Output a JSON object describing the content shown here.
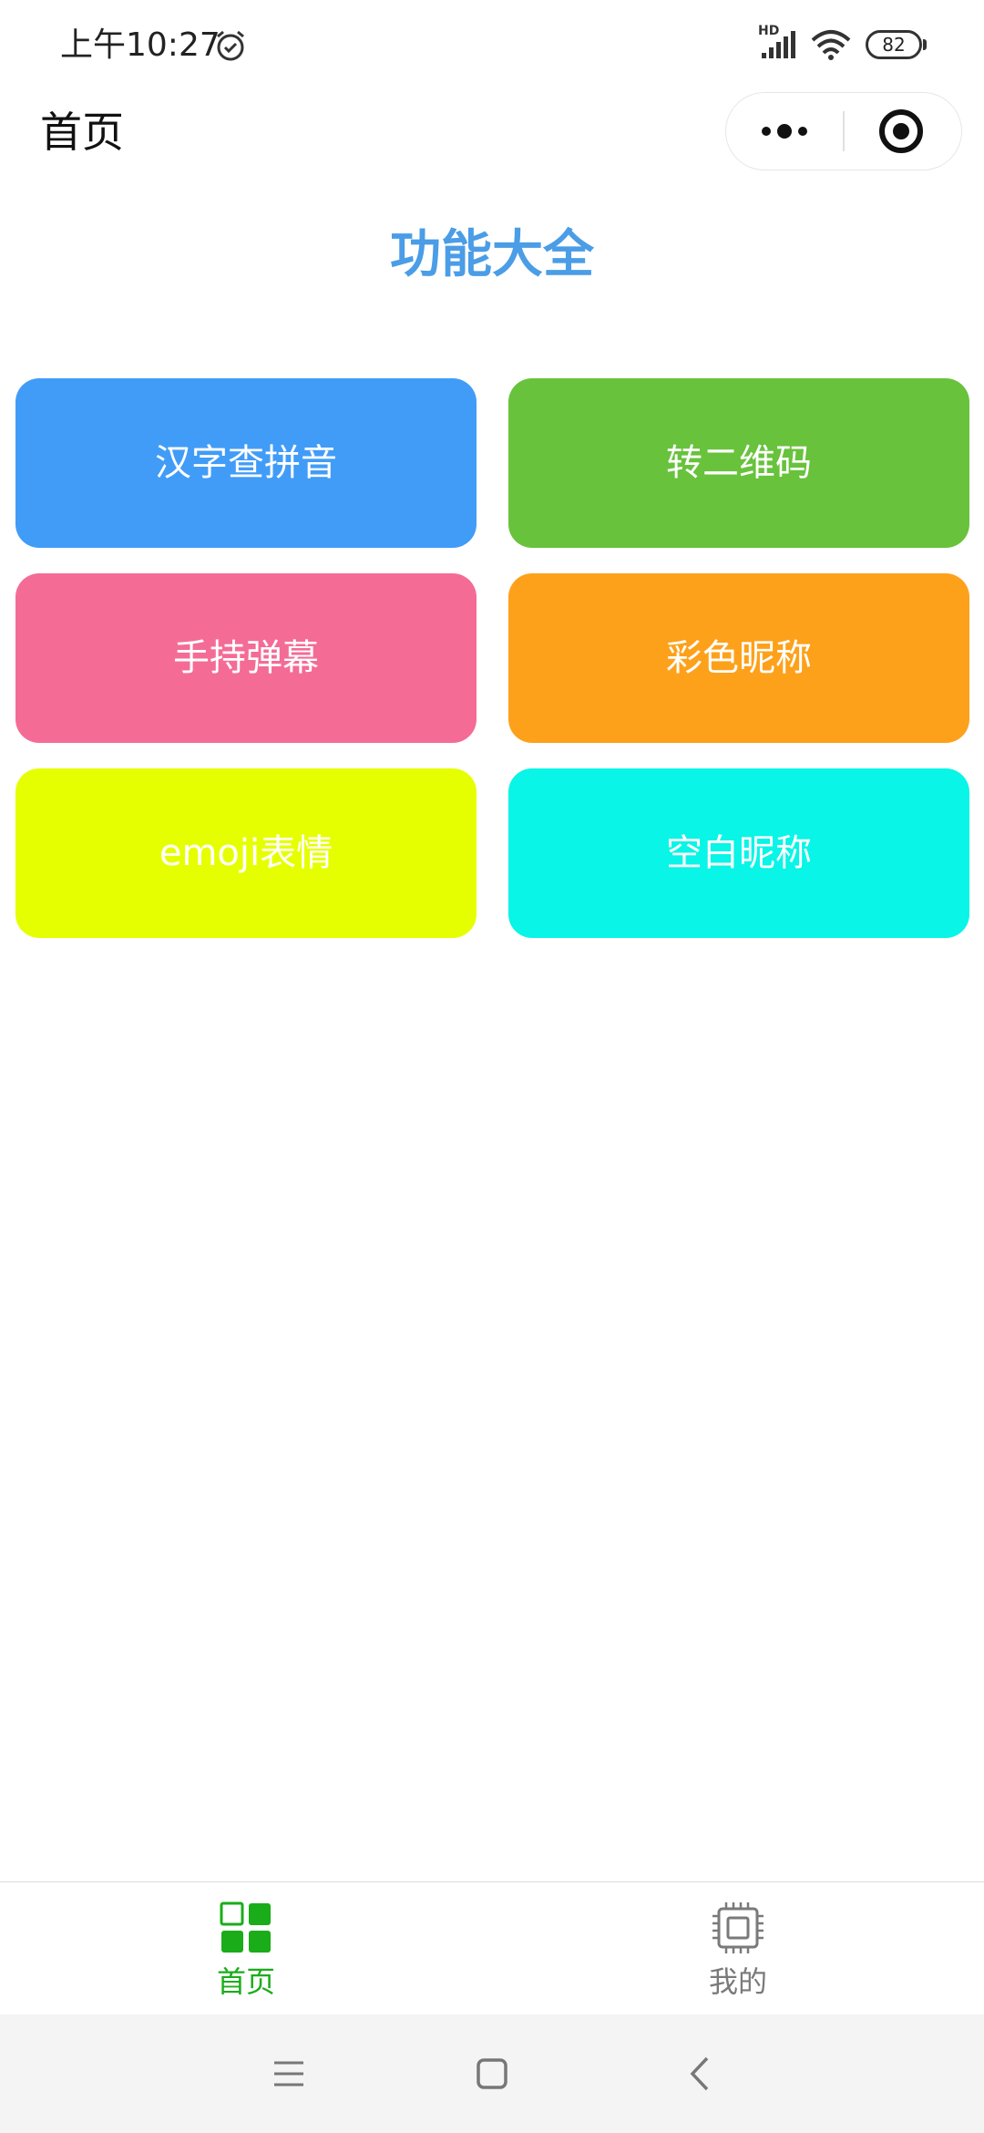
{
  "status_bar": {
    "time": "上午10:27",
    "battery": "82",
    "network_badge": "HD",
    "icons": [
      "alarm-icon",
      "signal-icon",
      "wifi-icon",
      "battery-icon"
    ]
  },
  "nav": {
    "title": "首页",
    "capsule_icons": [
      "more-icon",
      "close-target-icon"
    ]
  },
  "heading": "功能大全",
  "tiles": [
    {
      "label": "汉字查拼音",
      "color": "#419cf8"
    },
    {
      "label": "转二维码",
      "color": "#68c23c"
    },
    {
      "label": "手持弹幕",
      "color": "#f46c96"
    },
    {
      "label": "彩色昵称",
      "color": "#fda11b"
    },
    {
      "label": "emoji表情",
      "color": "#e6ff00"
    },
    {
      "label": "空白昵称",
      "color": "#08f5e7"
    }
  ],
  "tab_bar": {
    "items": [
      {
        "label": "首页",
        "icon": "grid-icon",
        "active": true,
        "color": "#1aad19"
      },
      {
        "label": "我的",
        "icon": "chip-icon",
        "active": false,
        "color": "#7a7a7a"
      }
    ]
  },
  "system_nav": {
    "icons": [
      "menu-icon",
      "home-square-icon",
      "back-icon"
    ]
  },
  "colors": {
    "heading": "#4a9de6",
    "tab_active": "#1aad19",
    "tab_inactive": "#7a7a7a"
  }
}
